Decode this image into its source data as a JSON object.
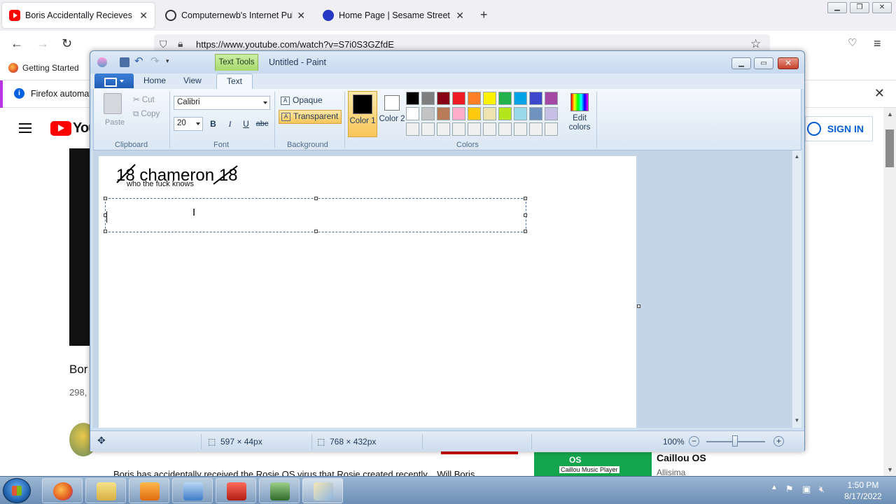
{
  "browser": {
    "tabs": [
      {
        "title": "Boris Accidentally Recieves Ros",
        "active": true,
        "icon": "youtube-icon"
      },
      {
        "title": "Computernewb's Internet Pub",
        "active": false,
        "icon": "pub-icon"
      },
      {
        "title": "Home Page | Sesame Street | PB",
        "active": false,
        "icon": "pbs-icon"
      }
    ],
    "url": "https://www.youtube.com/watch?v=S7i0S3GZfdE",
    "bookmark": "Getting Started",
    "info_message": "Firefox automat"
  },
  "youtube": {
    "logo_text": "You",
    "sign_in": "SIGN IN",
    "video_title": "Bor",
    "views": "298,",
    "description": "Boris has accidentally received the Rosie OS virus that Rosie created recently... Will Boris",
    "related": {
      "thumb_title": "OS",
      "thumb_sub": "Caillou Music Player",
      "title": "Caillou OS",
      "channel": "Allisima"
    }
  },
  "paint": {
    "title": "Untitled - Paint",
    "context_tab": "Text Tools",
    "ribbon_tabs": [
      "Home",
      "View",
      "Text"
    ],
    "active_tab": "Text",
    "clipboard": {
      "paste": "Paste",
      "cut": "Cut",
      "copy": "Copy",
      "group": "Clipboard"
    },
    "font": {
      "family": "Calibri",
      "size": "20",
      "group": "Font",
      "bold": "B",
      "italic": "I",
      "underline": "U",
      "strike": "abc"
    },
    "background": {
      "opaque": "Opaque",
      "transparent": "Transparent",
      "group": "Background",
      "selected": "Transparent"
    },
    "colors": {
      "color1_label": "Color 1",
      "color2_label": "Color 2",
      "color1": "#000000",
      "color2": "#ffffff",
      "edit_label": "Edit colors",
      "group": "Colors",
      "palette_row1": [
        "#000000",
        "#7f7f7f",
        "#880015",
        "#ed1c24",
        "#ff7f27",
        "#fff200",
        "#22b14c",
        "#00a2e8",
        "#3f48cc",
        "#a349a4"
      ],
      "palette_row2": [
        "#ffffff",
        "#c3c3c3",
        "#b97a57",
        "#ffaec9",
        "#ffc90e",
        "#efe4b0",
        "#b5e61d",
        "#99d9ea",
        "#7092be",
        "#c8bfe7"
      ],
      "palette_row3": [
        "#f0f0f0",
        "#f0f0f0",
        "#f0f0f0",
        "#f0f0f0",
        "#f0f0f0",
        "#f0f0f0",
        "#f0f0f0",
        "#f0f0f0",
        "#f0f0f0",
        "#f0f0f0"
      ]
    },
    "canvas_text": {
      "line1": "18 chameron 18",
      "line2": "who the fuck knows"
    },
    "status": {
      "selection_size": "597 × 44px",
      "image_size": "768 × 432px",
      "zoom": "100%"
    }
  },
  "taskbar": {
    "time": "1:50 PM",
    "date": "8/17/2022"
  }
}
